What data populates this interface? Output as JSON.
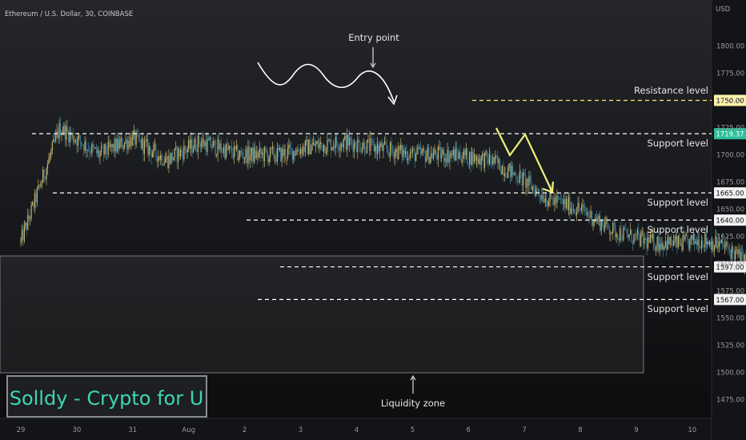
{
  "header": {
    "title": "Ethereum / U.S. Dollar, 30, COINBASE"
  },
  "currency": "USD",
  "watermark": "Solldy - Crypto for U",
  "chart_data": {
    "type": "candlestick",
    "symbol": "Ethereum / U.S. Dollar",
    "interval": "30",
    "exchange": "COINBASE",
    "ylim": [
      1462,
      1835
    ],
    "y_ticks": [
      1475,
      1500,
      1525,
      1550,
      1575,
      1600,
      1625,
      1650,
      1675,
      1700,
      1725,
      1750,
      1775,
      1800
    ],
    "y_tick_labels": [
      "1475.00",
      "1500.00",
      "1525.00",
      "1550.00",
      "1575.00",
      "1600.00",
      "1625.00",
      "1650.00",
      "1675.00",
      "1700.00",
      "1725.00",
      "1750.00",
      "1775.00",
      "1800.00"
    ],
    "x_ticks": [
      "29",
      "30",
      "31",
      "Aug",
      "2",
      "3",
      "4",
      "5",
      "6",
      "7",
      "8",
      "9",
      "10"
    ],
    "close_path": [
      [
        0,
        1620
      ],
      [
        0.7,
        1725
      ],
      [
        1.4,
        1700
      ],
      [
        2.0,
        1715
      ],
      [
        2.6,
        1695
      ],
      [
        3.2,
        1712
      ],
      [
        3.9,
        1700
      ],
      [
        4.6,
        1700
      ],
      [
        5.2,
        1708
      ],
      [
        5.8,
        1712
      ],
      [
        6.5,
        1705
      ],
      [
        7.1,
        1700
      ],
      [
        7.8,
        1700
      ],
      [
        8.4,
        1695
      ],
      [
        8.9,
        1680
      ],
      [
        9.4,
        1660
      ],
      [
        10.0,
        1650
      ],
      [
        10.6,
        1630
      ],
      [
        11.2,
        1620
      ],
      [
        11.8,
        1618
      ],
      [
        12.2,
        1622
      ],
      [
        12.6,
        1615
      ],
      [
        13.0,
        1600
      ],
      [
        13.5,
        1585
      ],
      [
        13.9,
        1575
      ],
      [
        14.4,
        1570
      ],
      [
        14.8,
        1575
      ],
      [
        15.2,
        1600
      ],
      [
        15.6,
        1630
      ],
      [
        16.1,
        1650
      ],
      [
        16.7,
        1625
      ],
      [
        17.2,
        1610
      ],
      [
        17.8,
        1640
      ],
      [
        18.4,
        1665
      ],
      [
        19.0,
        1665
      ],
      [
        19.6,
        1660
      ],
      [
        20.2,
        1640
      ],
      [
        20.8,
        1628
      ],
      [
        21.3,
        1640
      ],
      [
        21.8,
        1625
      ],
      [
        22.4,
        1610
      ],
      [
        23.0,
        1605
      ],
      [
        23.5,
        1608
      ],
      [
        24.0,
        1592
      ],
      [
        24.6,
        1595
      ],
      [
        25.2,
        1605
      ],
      [
        25.8,
        1660
      ],
      [
        26.6,
        1665
      ],
      [
        27.4,
        1705
      ],
      [
        28.1,
        1715
      ],
      [
        28.6,
        1700
      ],
      [
        29.1,
        1675
      ],
      [
        29.6,
        1700
      ],
      [
        30.1,
        1725
      ],
      [
        30.6,
        1740
      ],
      [
        31.1,
        1728
      ],
      [
        31.6,
        1720
      ],
      [
        32.3,
        1716
      ],
      [
        32.8,
        1710
      ],
      [
        33.1,
        1712
      ]
    ],
    "levels": [
      {
        "price": 1750.0,
        "price_label": "1750.00",
        "label": "Resistance level",
        "color": "#ffeb6b"
      },
      {
        "price": 1719.37,
        "price_label": "1719.37",
        "label": "Support level",
        "color": "#ffffff",
        "current": true
      },
      {
        "price": 1665.0,
        "price_label": "1665.00",
        "label": "Support level",
        "color": "#ffffff"
      },
      {
        "price": 1640.0,
        "price_label": "1640.00",
        "label": "Support level",
        "color": "#ffffff"
      },
      {
        "price": 1597.0,
        "price_label": "1597.00",
        "label": "Support level",
        "color": "#ffffff"
      },
      {
        "price": 1567.0,
        "price_label": "1567.00",
        "label": "Support level",
        "color": "#ffffff"
      }
    ],
    "zone": {
      "label": "Liquidity zone",
      "top": 1605,
      "bottom": 1500
    },
    "annotations": {
      "entry": "Entry point",
      "liquidity": "Liquidity zone"
    },
    "colors": {
      "up": "#c7b46a",
      "down": "#3c7f95",
      "current": "#2bbf9a",
      "resistance": "#ffeb6b",
      "projection": "#eef07a"
    }
  }
}
